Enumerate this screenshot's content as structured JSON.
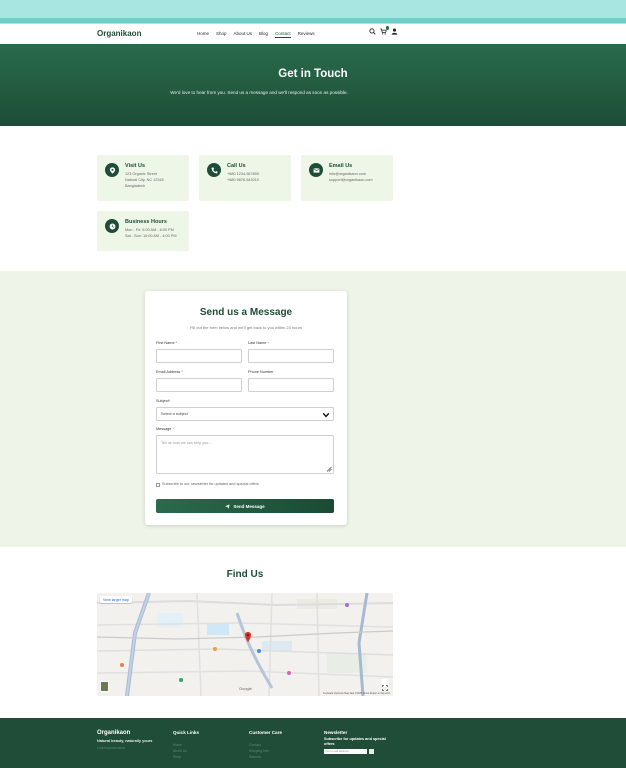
{
  "nav": {
    "brand": "Organikaon",
    "links": [
      "Home",
      "Shop",
      "About Us",
      "Blog",
      "Contact",
      "Reviews"
    ],
    "active_index": 4
  },
  "icons": {
    "search": "search-icon",
    "cart": "cart-icon",
    "user": "user-icon",
    "location": "map-pin-icon",
    "phone": "phone-icon",
    "email": "envelope-icon",
    "hours": "clock-icon",
    "send": "paper-plane-icon"
  },
  "hero": {
    "title": "Get in Touch",
    "subtitle": "We'd love to hear from you. Send us a message and we'll respond as soon as possible."
  },
  "cards": [
    {
      "title": "Visit Us",
      "lines": [
        "123 Organic Street",
        "Natural City, NC 12345",
        "Bangladesh"
      ]
    },
    {
      "title": "Call Us",
      "lines": [
        "+880 1234-567890",
        "+880 9876-543210"
      ]
    },
    {
      "title": "Email Us",
      "lines": [
        "info@organikaon.com",
        "support@organikaon.com"
      ]
    },
    {
      "title": "Business Hours",
      "lines": [
        "Mon - Fri: 9:00 AM - 6:00 PM",
        "Sat - Sun: 10:00 AM - 4:00 PM"
      ]
    }
  ],
  "form": {
    "title": "Send us a Message",
    "subtitle": "Fill out the form below and we'll get back to you within 24 hours",
    "first_name_label": "First Name",
    "last_name_label": "Last Name",
    "email_label": "Email Address",
    "phone_label": "Phone Number",
    "subject_label": "Subject",
    "subject_value": "Select a subject",
    "message_label": "Message",
    "message_placeholder": "Tell us how we can help you...",
    "required_mark": "*",
    "newsletter_label": "Subscribe to our newsletter for updates and special offers",
    "send_label": "Send Message"
  },
  "find": {
    "title": "Find Us",
    "view_larger": "View larger map",
    "google": "Google",
    "attribution": "Keyboard shortcuts   Map data ©2025   Terms   Report a map error"
  },
  "footer": {
    "brand": "Organikaon",
    "tagline": "Natural beauty, naturally yours",
    "brand_faint": "Lorem ipsum dolor",
    "quick_title": "Quick Links",
    "quick_items": [
      "Home",
      "About Us",
      "Shop"
    ],
    "care_title": "Customer Care",
    "care_items": [
      "Contact",
      "Shipping Info",
      "Returns"
    ],
    "news_title": "Newsletter",
    "news_sub": "Subscribe for updates and special offers",
    "news_placeholder": "Your email address"
  },
  "colors": {
    "brand_green": "#1e4d37",
    "hero_green": "#2a6b4c",
    "card_bg": "#eef6e7",
    "topbar": "#a8e6e2",
    "footer_bg": "#1f4d37"
  }
}
